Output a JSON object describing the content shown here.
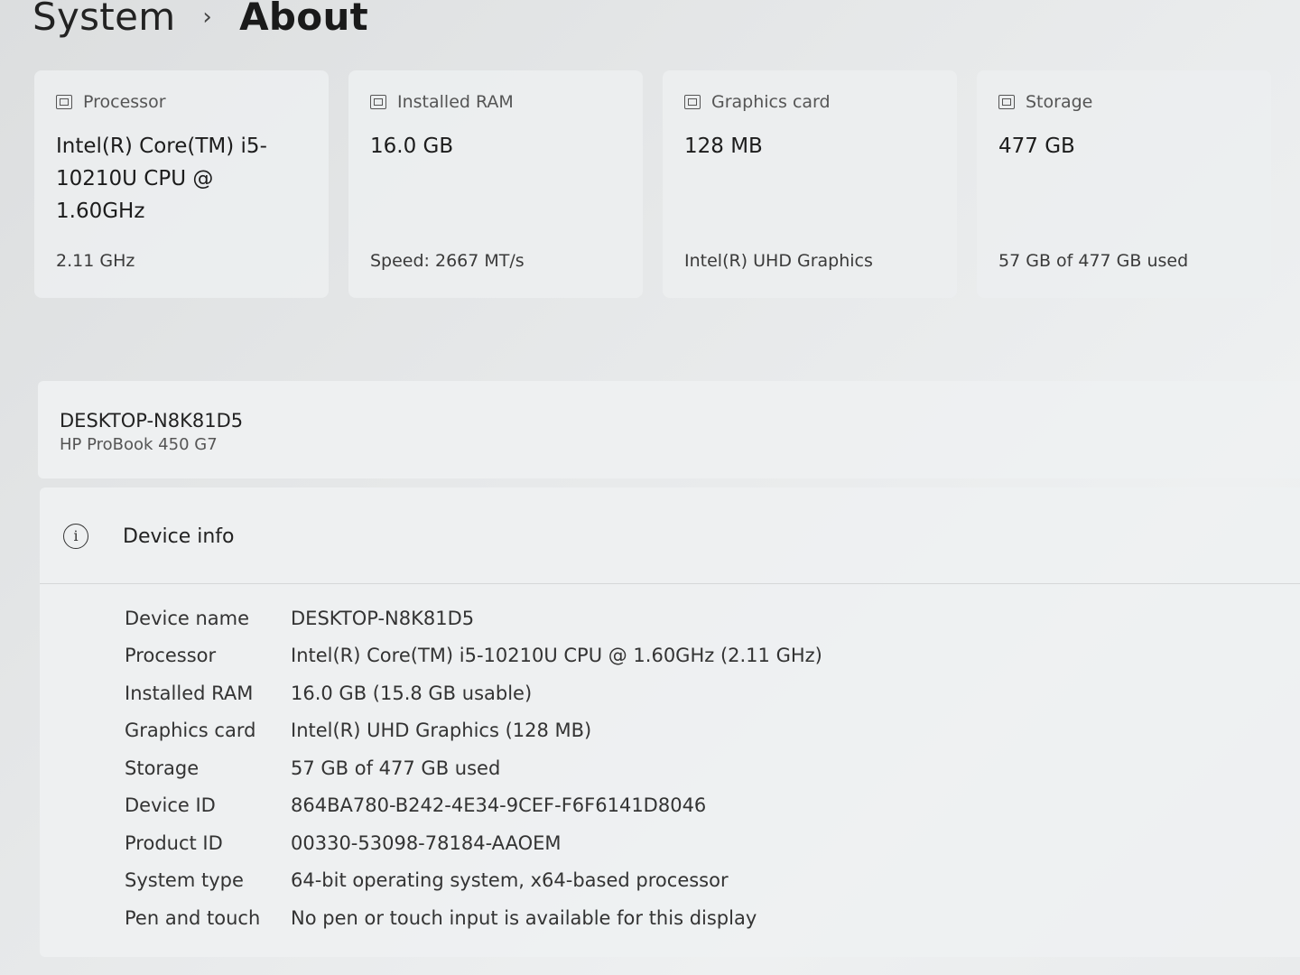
{
  "breadcrumb": {
    "parent": "System",
    "separator": "›",
    "current": "About"
  },
  "spec_cards": [
    {
      "icon": "processor-icon",
      "label": "Processor",
      "value": "Intel(R) Core(TM) i5-10210U CPU @ 1.60GHz",
      "sub": "2.11 GHz"
    },
    {
      "icon": "ram-icon",
      "label": "Installed RAM",
      "value": "16.0 GB",
      "sub": "Speed: 2667 MT/s"
    },
    {
      "icon": "graphics-card-icon",
      "label": "Graphics card",
      "value": "128 MB",
      "sub": "Intel(R) UHD Graphics"
    },
    {
      "icon": "storage-icon",
      "label": "Storage",
      "value": "477 GB",
      "sub": "57 GB of 477 GB used"
    }
  ],
  "device": {
    "name": "DESKTOP-N8K81D5",
    "model": "HP ProBook 450 G7"
  },
  "device_info": {
    "icon": "info-icon",
    "title": "Device info",
    "rows": [
      {
        "key": "Device name",
        "value": "DESKTOP-N8K81D5"
      },
      {
        "key": "Processor",
        "value": "Intel(R) Core(TM) i5-10210U CPU @ 1.60GHz (2.11 GHz)"
      },
      {
        "key": "Installed RAM",
        "value": "16.0 GB (15.8 GB usable)"
      },
      {
        "key": "Graphics card",
        "value": "Intel(R) UHD Graphics (128 MB)"
      },
      {
        "key": "Storage",
        "value": "57 GB of 477 GB used"
      },
      {
        "key": "Device ID",
        "value": "864BA780-B242-4E34-9CEF-F6F6141D8046"
      },
      {
        "key": "Product ID",
        "value": "00330-53098-78184-AAOEM"
      },
      {
        "key": "System type",
        "value": "64-bit operating system, x64-based processor"
      },
      {
        "key": "Pen and touch",
        "value": "No pen or touch input is available for this display"
      }
    ]
  }
}
